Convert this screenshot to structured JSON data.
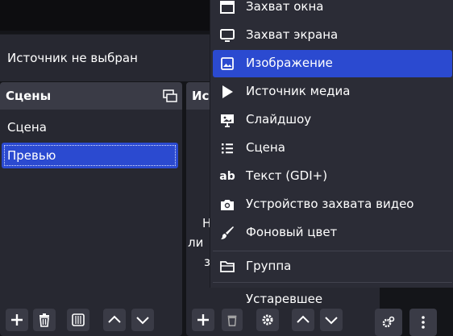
{
  "source_status": "Источник не выбран",
  "scenes": {
    "title": "Сцены",
    "items": [
      "Сцена",
      "Превью"
    ],
    "selected_index": 1
  },
  "sources": {
    "title_visible": "Ис",
    "hint_lines": [
      "Н",
      "ли",
      "з"
    ]
  },
  "menu": {
    "items": [
      {
        "label": "Захват окна",
        "icon": "window-capture-icon"
      },
      {
        "label": "Захват экрана",
        "icon": "monitor-icon"
      },
      {
        "label": "Изображение",
        "icon": "image-icon",
        "active": true
      },
      {
        "label": "Источник медиа",
        "icon": "play-icon"
      },
      {
        "label": "Слайдшоу",
        "icon": "slideshow-icon"
      },
      {
        "label": "Сцена",
        "icon": "list-icon"
      },
      {
        "label": "Текст (GDI+)",
        "icon": "text-icon"
      },
      {
        "label": "Устройство захвата видео",
        "icon": "camera-icon"
      },
      {
        "label": "Фоновый цвет",
        "icon": "brush-icon"
      },
      {
        "label": "Группа",
        "icon": "folder-icon"
      },
      {
        "label": "Устаревшее",
        "icon": ""
      }
    ]
  },
  "colors": {
    "accent": "#2b4ad0",
    "dock_bg": "#272831",
    "header_bg": "#3a3b46",
    "menu_bg": "#2b2c36"
  }
}
